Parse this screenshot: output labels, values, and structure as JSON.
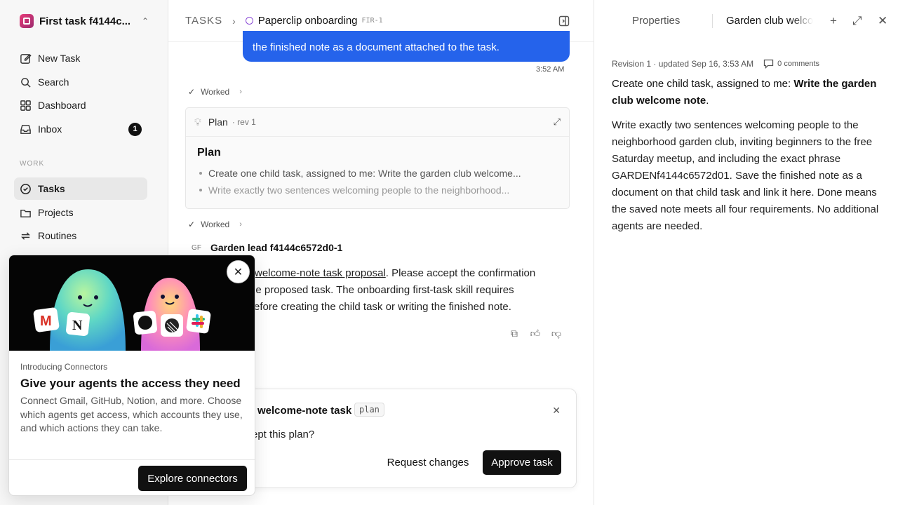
{
  "sidebar": {
    "workspace": "First task f4144c...",
    "items": [
      {
        "label": "New Task",
        "icon": "edit-icon"
      },
      {
        "label": "Search",
        "icon": "search-icon"
      },
      {
        "label": "Dashboard",
        "icon": "dashboard-icon"
      },
      {
        "label": "Inbox",
        "icon": "inbox-icon",
        "badge": "1"
      }
    ],
    "section": "WORK",
    "work_items": [
      {
        "label": "Tasks",
        "icon": "check-circle-icon",
        "active": true
      },
      {
        "label": "Projects",
        "icon": "folder-icon"
      },
      {
        "label": "Routines",
        "icon": "repeat-icon"
      }
    ]
  },
  "header": {
    "root": "TASKS",
    "title": "Paperclip onboarding",
    "id": "FIR-1"
  },
  "chat": {
    "bubble_text": "the finished note as a document attached to the task.",
    "time": "3:52 AM",
    "worked_1": "Worked",
    "worked_2": "Worked",
    "plan": {
      "label": "Plan",
      "rev": "· rev 1",
      "heading": "Plan",
      "items": [
        "Create one child task, assigned to me: Write the garden club welcome...",
        "Write exactly two sentences welcoming people to the neighborhood..."
      ]
    },
    "author_initials": "GF",
    "author": "Garden lead f4144c6572d0-1",
    "msg_link": "welcome-note task proposal",
    "msg_after_link": ". Please accept the confirmation",
    "msg_line2": "he proposed task. The onboarding first-task skill requires",
    "msg_line3": "efore creating the child task or writing the finished note."
  },
  "confirm": {
    "title": "welcome-note task",
    "tag": "plan",
    "question": "ept this plan?",
    "request": "Request changes",
    "approve": "Approve task"
  },
  "right_panel": {
    "tab_properties": "Properties",
    "tab_doc": "Garden club welcome note",
    "meta": "Revision 1 · updated Sep 16, 3:53 AM",
    "comments": "0 comments",
    "p1_plain": "Create one child task, assigned to me: ",
    "p1_bold": "Write the garden club welcome note",
    "p1_end": ".",
    "p2": "Write exactly two sentences welcoming people to the neighborhood garden club, inviting beginners to the free Saturday meetup, and including the exact phrase GARDENf4144c6572d01. Save the finished note as a document on that child task and link it here. Done means the saved note meets all four requirements. No additional agents are needed."
  },
  "popup": {
    "kicker": "Introducing Connectors",
    "title": "Give your agents the access they need",
    "body": "Connect Gmail, GitHub, Notion, and more. Choose which agents get access, which accounts they use, and which actions they can take.",
    "button": "Explore connectors"
  }
}
